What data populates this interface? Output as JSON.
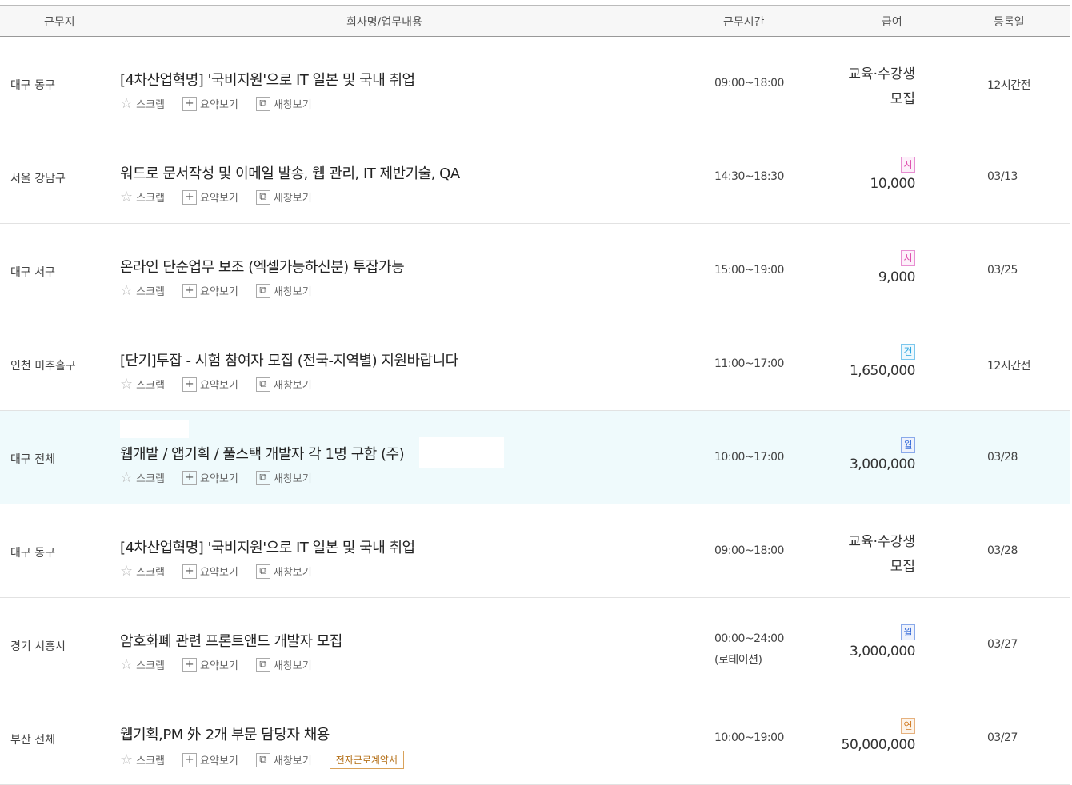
{
  "headers": {
    "location": "근무지",
    "company": "회사명/업무내용",
    "hours": "근무시간",
    "pay": "급여",
    "date": "등록일"
  },
  "actions": {
    "scrap": "스크랩",
    "summary": "요약보기",
    "newwin": "새창보기"
  },
  "rows": [
    {
      "location": "대구 동구",
      "title": "[4차산업혁명] '국비지원'으로 IT 일본 및 국내 취업",
      "time": "09:00~18:00",
      "pay_line1": "교육·수강생",
      "pay_line2": "모집",
      "date": "12시간전"
    },
    {
      "location": "서울 강남구",
      "title": "워드로 문서작성 및 이메일 발송, 웹 관리, IT 제반기술, QA",
      "time": "14:30~18:30",
      "pay_type": "시",
      "pay_amount": "10,000",
      "date": "03/13"
    },
    {
      "location": "대구 서구",
      "title": "온라인 단순업무 보조 (엑셀가능하신분) 투잡가능",
      "time": "15:00~19:00",
      "pay_type": "시",
      "pay_amount": "9,000",
      "date": "03/25"
    },
    {
      "location": "인천 미추홀구",
      "title": "[단기]투잡 - 시험 참여자 모집 (전국-지역별) 지원바랍니다",
      "time": "11:00~17:00",
      "pay_type": "건",
      "pay_amount": "1,650,000",
      "date": "12시간전"
    },
    {
      "location": "대구 전체",
      "title": "웹개발 / 앱기획 / 풀스택 개발자 각 1명 구함 (주)",
      "time": "10:00~17:00",
      "pay_type": "월",
      "pay_amount": "3,000,000",
      "date": "03/28"
    },
    {
      "location": "대구 동구",
      "title": "[4차산업혁명] '국비지원'으로 IT 일본 및 국내 취업",
      "time": "09:00~18:00",
      "pay_line1": "교육·수강생",
      "pay_line2": "모집",
      "date": "03/28"
    },
    {
      "location": "경기 시흥시",
      "title": "암호화폐 관련 프론트앤드 개발자 모집",
      "time": "00:00~24:00",
      "time_note": "(로테이션)",
      "pay_type": "월",
      "pay_amount": "3,000,000",
      "date": "03/27"
    },
    {
      "location": "부산 전체",
      "title": "웹기획,PM 外 2개 부문 담당자 채용",
      "time": "10:00~19:00",
      "pay_type": "연",
      "pay_amount": "50,000,000",
      "date": "03/27",
      "tag": "전자근로계약서"
    }
  ]
}
